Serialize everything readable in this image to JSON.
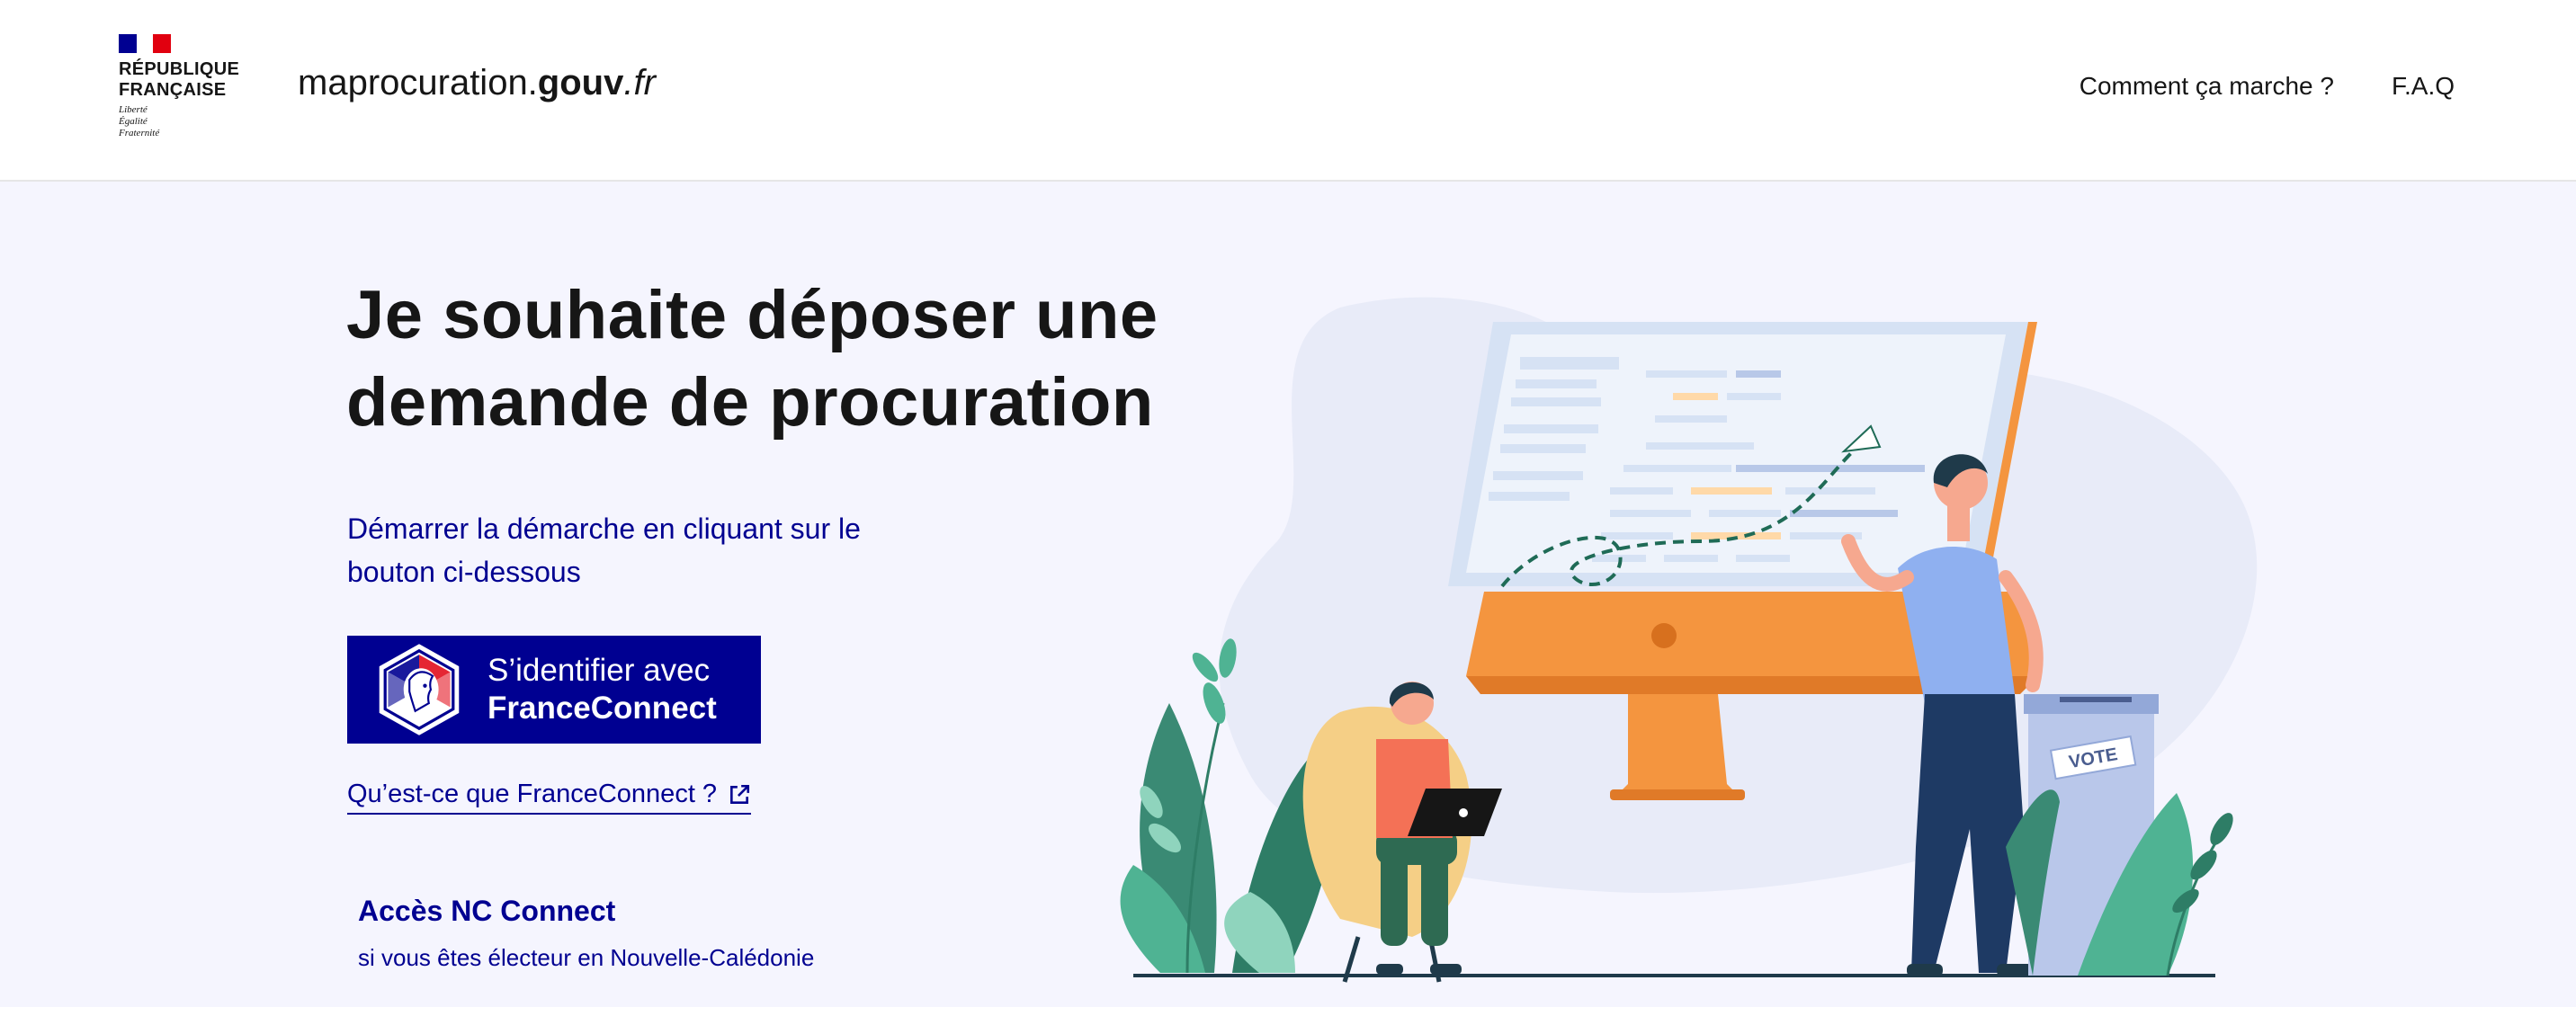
{
  "header": {
    "logo": {
      "name": "RÉPUBLIQUE\nFRANÇAISE",
      "motto": "Liberté\nÉgalité\nFraternité"
    },
    "site_title": {
      "part1": "maprocuration.",
      "part2": "gouv",
      "part3": ".fr"
    },
    "nav": [
      {
        "label": "Comment ça marche ?"
      },
      {
        "label": "F.A.Q"
      }
    ]
  },
  "main": {
    "title": "Je souhaite déposer une demande de procuration",
    "lead": "Démarrer la démarche en cliquant sur le bouton ci-dessous",
    "franceconnect_button": {
      "line1": "S’identifier avec",
      "line2": "FranceConnect"
    },
    "franceconnect_link": "Qu’est-ce que FranceConnect ?",
    "nc_connect": {
      "title": "Accès NC Connect",
      "subtitle": "si vous êtes électeur en Nouvelle-Calédonie"
    },
    "illustration": {
      "ballot_label": "VOTE"
    }
  },
  "colors": {
    "primary_blue": "#000091",
    "hero_bg": "#f5f5fe",
    "text": "#161616"
  }
}
